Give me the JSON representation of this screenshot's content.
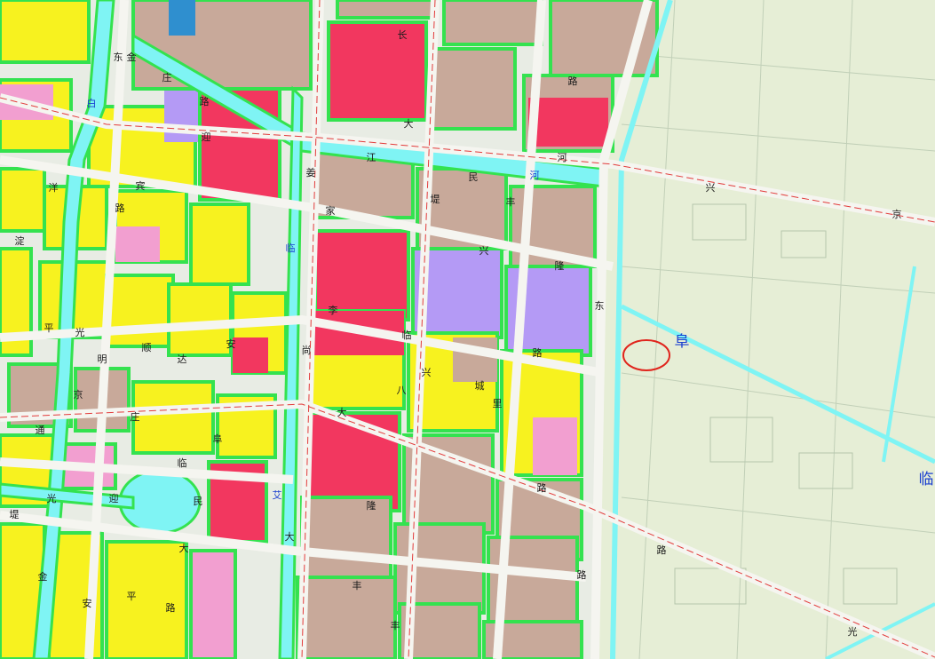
{
  "colors": {
    "residential": "#f7f21f",
    "commercial": "#f2375f",
    "public_service": "#c8a99a",
    "green": "#34e24f",
    "water": "#7ff4f4",
    "administrative": "#b49af5",
    "education": "#f29fd0",
    "rural_background": "#e6eed6",
    "road": "#e8ece4",
    "marker": "#e0241c"
  },
  "labels": {
    "yingbin_1": "迎",
    "yingbin_2": "宾",
    "yingbin_3": "路",
    "jiang_1": "姜",
    "jiang_2": "家",
    "jiang_3": "李",
    "chang_1": "长",
    "chang_2": "江",
    "chang_3": "大",
    "he_1": "河",
    "he_2": "堤",
    "bai_1": "白",
    "bai_2": "洋",
    "bai_3": "淀",
    "lin_1": "临",
    "lin_2": "尚",
    "jin_1": "金",
    "jin_2": "庄",
    "jin_3": "路",
    "min_1": "民",
    "min_2": "丰",
    "min_3": "路",
    "xing_1": "兴",
    "xing_2": "隆",
    "xing_3": "路",
    "guang_1": "光",
    "guang_2": "明",
    "ping_1": "平",
    "ping_2": "安",
    "shun_1": "顺",
    "shun_2": "达",
    "cheng_1": "城",
    "cheng_2": "东",
    "fu_1": "阜",
    "fu_2": "临",
    "fu_3": "路",
    "jing_1": "京",
    "jing_2": "通",
    "ai": "艾",
    "zhuang": "庄",
    "he_water": "河",
    "xing_lower": "兴",
    "dongguang_1": "东",
    "dongguang_2": "光",
    "ba_1": "八",
    "ba_2": "里",
    "fu_big": "阜",
    "lin_big": "临"
  }
}
